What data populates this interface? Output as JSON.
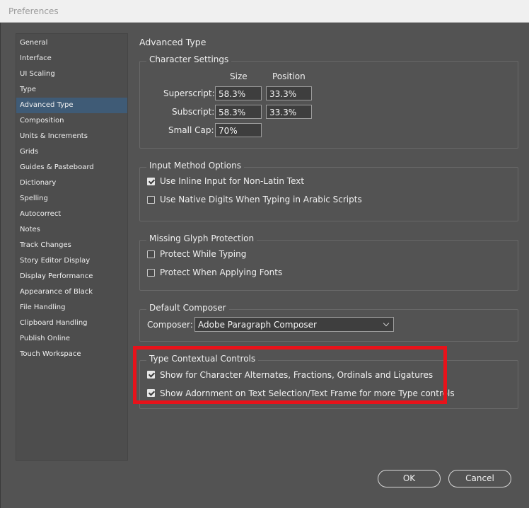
{
  "window": {
    "title": "Preferences"
  },
  "sidebar": {
    "items": [
      {
        "label": "General"
      },
      {
        "label": "Interface"
      },
      {
        "label": "UI Scaling"
      },
      {
        "label": "Type"
      },
      {
        "label": "Advanced Type"
      },
      {
        "label": "Composition"
      },
      {
        "label": "Units & Increments"
      },
      {
        "label": "Grids"
      },
      {
        "label": "Guides & Pasteboard"
      },
      {
        "label": "Dictionary"
      },
      {
        "label": "Spelling"
      },
      {
        "label": "Autocorrect"
      },
      {
        "label": "Notes"
      },
      {
        "label": "Track Changes"
      },
      {
        "label": "Story Editor Display"
      },
      {
        "label": "Display Performance"
      },
      {
        "label": "Appearance of Black"
      },
      {
        "label": "File Handling"
      },
      {
        "label": "Clipboard Handling"
      },
      {
        "label": "Publish Online"
      },
      {
        "label": "Touch Workspace"
      }
    ],
    "selected": "Advanced Type"
  },
  "main": {
    "title": "Advanced Type",
    "character_settings": {
      "legend": "Character Settings",
      "col_size": "Size",
      "col_position": "Position",
      "superscript_label": "Superscript:",
      "superscript_size": "58.3%",
      "superscript_position": "33.3%",
      "subscript_label": "Subscript:",
      "subscript_size": "58.3%",
      "subscript_position": "33.3%",
      "smallcap_label": "Small Cap:",
      "smallcap_value": "70%"
    },
    "input_method": {
      "legend": "Input Method Options",
      "inline_input_label": "Use Inline Input for Non-Latin Text",
      "inline_input_checked": true,
      "native_digits_label": "Use Native Digits When Typing in Arabic Scripts",
      "native_digits_checked": false
    },
    "missing_glyph": {
      "legend": "Missing Glyph Protection",
      "while_typing_label": "Protect While Typing",
      "while_typing_checked": false,
      "applying_fonts_label": "Protect When Applying Fonts",
      "applying_fonts_checked": false
    },
    "default_composer": {
      "legend": "Default Composer",
      "composer_label": "Composer:",
      "composer_value": "Adobe Paragraph Composer"
    },
    "contextual_controls": {
      "legend": "Type Contextual Controls",
      "alternates_label": "Show for Character Alternates, Fractions, Ordinals and Ligatures",
      "alternates_checked": true,
      "adornment_label": "Show Adornment on Text Selection/Text Frame for more Type controls",
      "adornment_checked": true
    }
  },
  "footer": {
    "ok_label": "OK",
    "cancel_label": "Cancel"
  },
  "colors": {
    "highlight": "#e8121a",
    "selected_item": "#3f5b76",
    "background": "#535353"
  }
}
